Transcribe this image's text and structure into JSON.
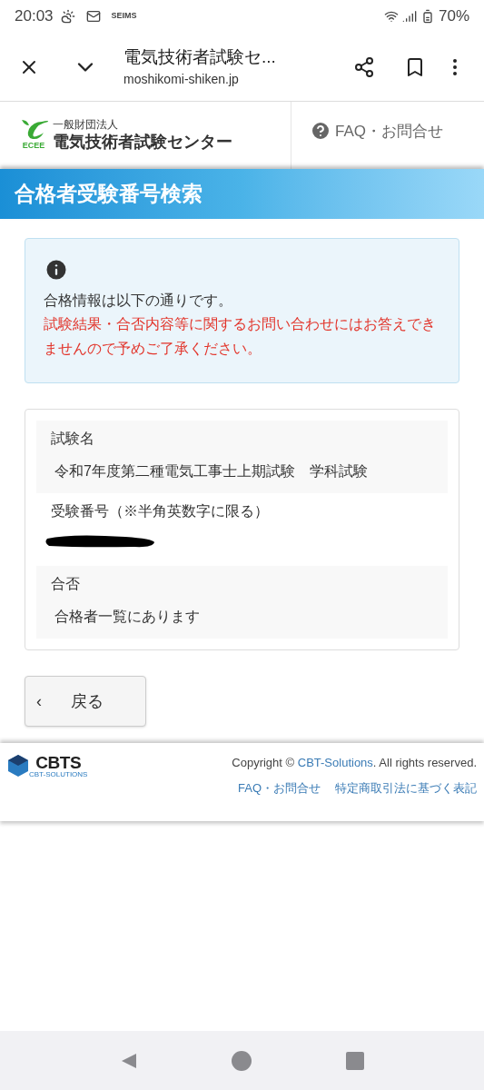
{
  "status_bar": {
    "time": "20:03",
    "notification_text": "SEIMS",
    "battery": "70%"
  },
  "browser": {
    "title": "電気技術者試験セ...",
    "url": "moshikomi-shiken.jp"
  },
  "site_header": {
    "logo_mark": "ECEE",
    "org_type": "一般財団法人",
    "org_name": "電気技術者試験センター",
    "faq_link": "FAQ・お問合せ"
  },
  "page_title": "合格者受験番号検索",
  "notice": {
    "message": "合格情報は以下の通りです。",
    "warning": "試験結果・合否内容等に関するお問い合わせにはお答えできませんので予めご了承ください。"
  },
  "result": [
    {
      "kind": "text",
      "label": "試験名",
      "value": "令和7年度第二種電気工事士上期試験　学科試験"
    },
    {
      "kind": "redacted",
      "label": "受験番号（※半角英数字に限る）"
    },
    {
      "kind": "text",
      "label": "合否",
      "value": "合格者一覧にあります"
    }
  ],
  "back_button": {
    "icon": "‹",
    "label": "戻る"
  },
  "footer": {
    "logo_text": "CBTS",
    "logo_subtext": "CBT-SOLUTIONS",
    "copyright_prefix": "Copyright ©",
    "copyright_link": "CBT-Solutions",
    "copyright_suffix": ". All rights reserved.",
    "links": [
      "FAQ・お問合せ",
      "特定商取引法に基づく表記"
    ]
  }
}
